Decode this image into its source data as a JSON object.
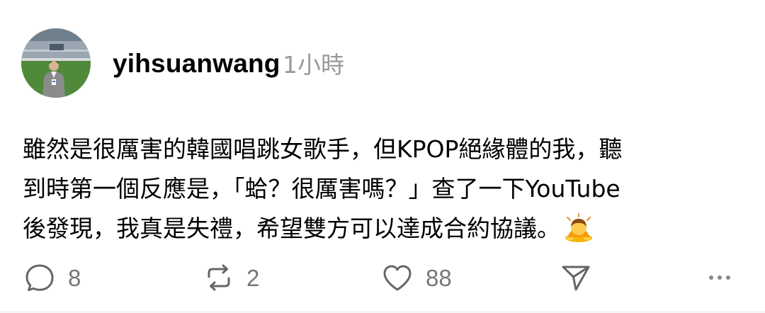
{
  "post": {
    "author": "yihsuanwang",
    "time_ago": "1小時",
    "body_lines": [
      "雖然是很厲害的韓國唱跳女歌手，但KPOP絕緣體的我，聽",
      "到時第一個反應是，「蛤？很厲害嗎？」查了一下YouTube",
      "後發現，我真是失禮，希望雙方可以達成合約協議。"
    ],
    "trailing_emoji": "bowing-person-emoji"
  },
  "actions": {
    "reply_count": "8",
    "repost_count": "2",
    "like_count": "88",
    "share_icon": "send-icon",
    "more_icon": "more-dots-icon"
  },
  "colors": {
    "text": "#000000",
    "secondary": "#999999",
    "icon": "#777777",
    "background": "#ffffff"
  }
}
